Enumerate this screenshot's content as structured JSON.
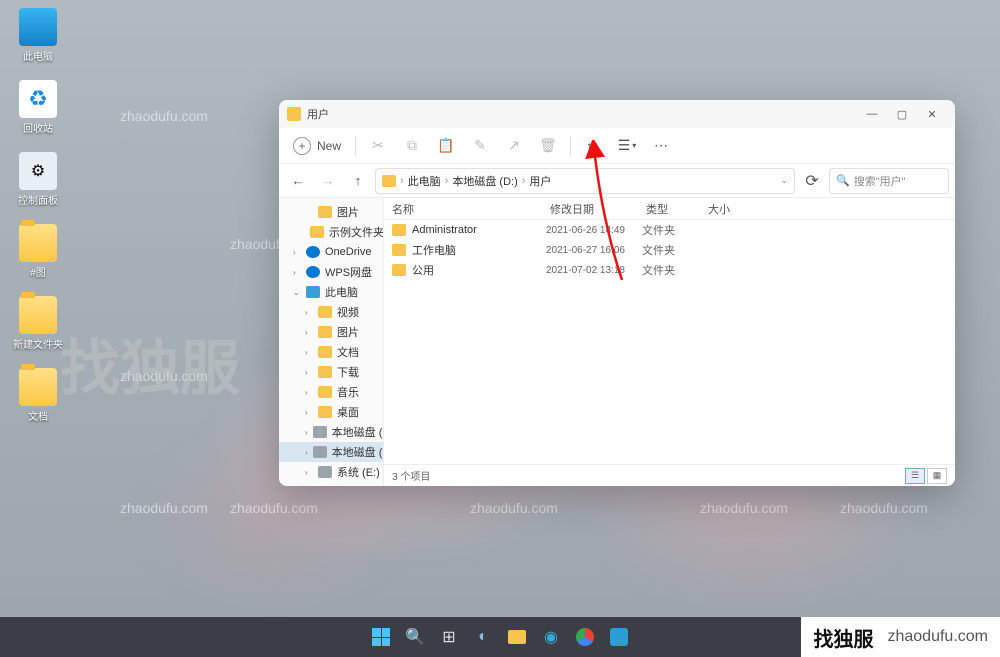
{
  "desktop": {
    "icons": [
      {
        "name": "pc",
        "label": "此电脑"
      },
      {
        "name": "recycle",
        "label": "回收站"
      },
      {
        "name": "control",
        "label": "控制面板"
      },
      {
        "name": "folder1",
        "label": "#图"
      },
      {
        "name": "folder2",
        "label": "新建文件夹"
      },
      {
        "name": "folder3",
        "label": "文档"
      }
    ]
  },
  "watermarks": {
    "url": "zhaodufu.com",
    "big": "找独服"
  },
  "explorer": {
    "title": "用户",
    "toolbar": {
      "new": "New"
    },
    "breadcrumb": {
      "pc": "此电脑",
      "drive": "本地磁盘 (D:)",
      "folder": "用户"
    },
    "search_placeholder": "搜索\"用户\"",
    "columns": {
      "name": "名称",
      "date": "修改日期",
      "type": "类型",
      "size": "大小"
    },
    "nav": [
      {
        "label": "图片",
        "kind": "folder",
        "lvl": 1
      },
      {
        "label": "示例文件夹",
        "kind": "folder",
        "lvl": 1
      },
      {
        "label": "OneDrive",
        "kind": "cloud",
        "lvl": 0,
        "chev": "›"
      },
      {
        "label": "WPS网盘",
        "kind": "cloud",
        "lvl": 0,
        "chev": "›"
      },
      {
        "label": "此电脑",
        "kind": "pc",
        "lvl": 0,
        "chev": "⌄"
      },
      {
        "label": "视频",
        "kind": "folder",
        "lvl": 1,
        "chev": "›"
      },
      {
        "label": "图片",
        "kind": "folder",
        "lvl": 1,
        "chev": "›"
      },
      {
        "label": "文档",
        "kind": "folder",
        "lvl": 1,
        "chev": "›"
      },
      {
        "label": "下载",
        "kind": "folder",
        "lvl": 1,
        "chev": "›"
      },
      {
        "label": "音乐",
        "kind": "folder",
        "lvl": 1,
        "chev": "›"
      },
      {
        "label": "桌面",
        "kind": "folder",
        "lvl": 1,
        "chev": "›"
      },
      {
        "label": "本地磁盘 (C:)",
        "kind": "drive",
        "lvl": 1,
        "chev": "›"
      },
      {
        "label": "本地磁盘 (D:)",
        "kind": "drive",
        "lvl": 1,
        "chev": "›",
        "sel": true
      },
      {
        "label": "系统 (E:)",
        "kind": "drive",
        "lvl": 1,
        "chev": "›"
      }
    ],
    "rows": [
      {
        "name": "Administrator",
        "date": "2021-06-26 14:49",
        "type": "文件夹"
      },
      {
        "name": "工作电脑",
        "date": "2021-06-27 16:06",
        "type": "文件夹"
      },
      {
        "name": "公用",
        "date": "2021-07-02 13:18",
        "type": "文件夹"
      }
    ],
    "status": "3 个项目"
  },
  "corner": {
    "brand": "找独服",
    "url": "zhaodufu.com"
  }
}
